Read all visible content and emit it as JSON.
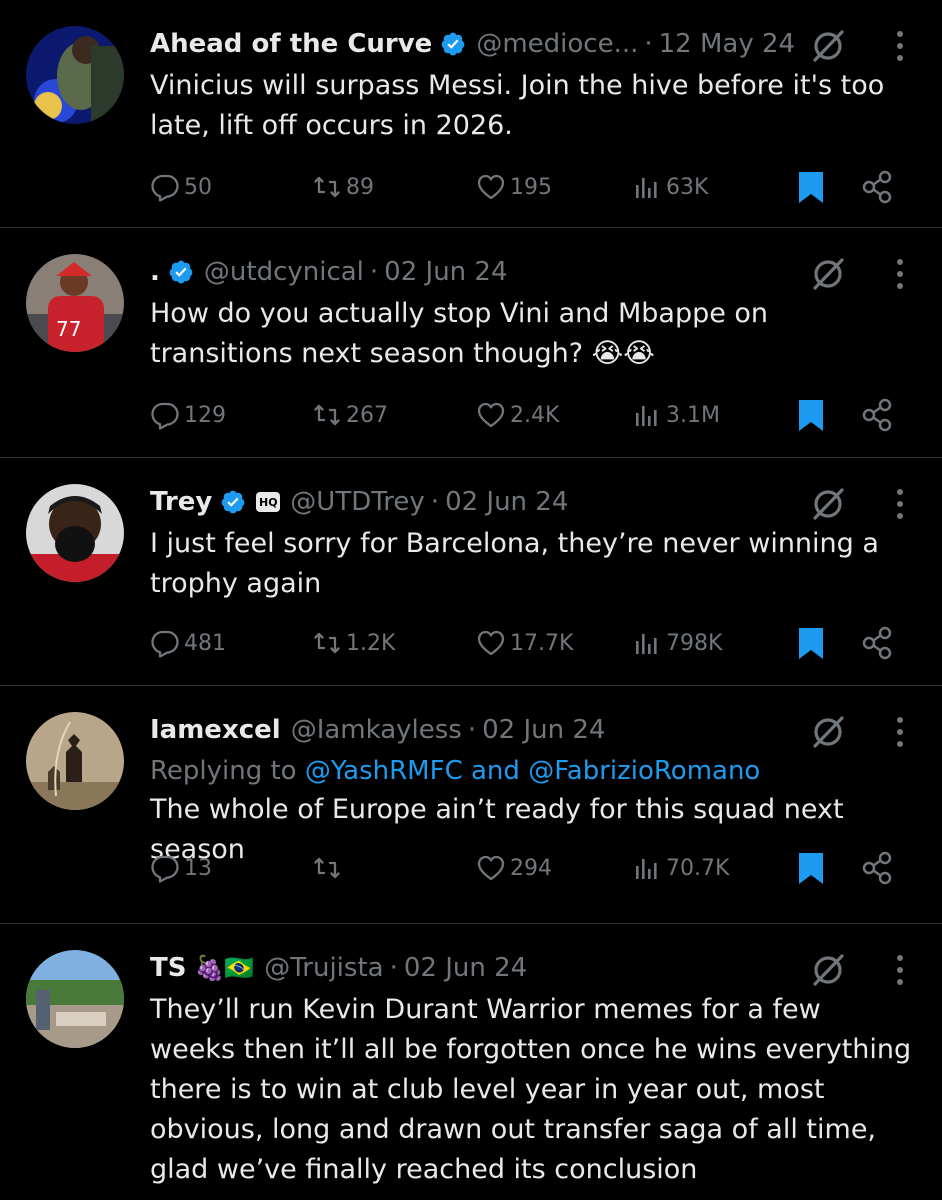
{
  "colors": {
    "background": "#000000",
    "text": "#e7e9ea",
    "muted": "#71767b",
    "accent": "#1d9bf0",
    "divider": "#2f3336"
  },
  "icons": {
    "verified": "verified-badge-icon",
    "grok": "grok-icon",
    "more": "more-vertical-icon",
    "reply": "reply-icon",
    "retweet": "retweet-icon",
    "like": "heart-icon",
    "views": "analytics-icon",
    "bookmark": "bookmark-icon",
    "share": "share-icon"
  },
  "tweets": [
    {
      "name": "Ahead of the Curve",
      "handle": "@medioce...",
      "date": "12 May 24",
      "text": "Vinicius will surpass Messi. Join the hive before it's too late, lift off occurs in 2026.",
      "replies": "50",
      "retweets": "89",
      "likes": "195",
      "views": "63K"
    },
    {
      "name": ".",
      "handle": "@utdcynical",
      "date": "02 Jun 24",
      "text": "How do you actually stop Vini and Mbappe on transitions next season though? 😭😭",
      "replies": "129",
      "retweets": "267",
      "likes": "2.4K",
      "views": "3.1M"
    },
    {
      "name": "Trey",
      "handle": "@UTDTrey",
      "date": "02 Jun 24",
      "text": "I just feel sorry for Barcelona, they’re never winning a trophy again",
      "replies": "481",
      "retweets": "1.2K",
      "likes": "17.7K",
      "views": "798K"
    },
    {
      "name": "Iamexcel",
      "handle": "@Iamkayless",
      "date": "02 Jun 24",
      "reply_prefix": "Replying to ",
      "reply_mention_1": "@YashRMFC",
      "reply_and": " and ",
      "reply_mention_2": "@FabrizioRomano",
      "text": "The whole of Europe ain’t ready for this squad next season",
      "replies": "13",
      "retweets": "",
      "likes": "294",
      "views": "70.7K"
    },
    {
      "name": "TS",
      "name_emoji": "🍇🇧🇷",
      "handle": "@Trujista",
      "date": "02 Jun 24",
      "text": "They’ll run Kevin Durant Warrior memes for a few weeks then it’ll all be forgotten once he wins everything there is to win at club level year in year out, most obvious, long and drawn out transfer saga of all time, glad we’ve finally reached its conclusion"
    }
  ],
  "separator": "·"
}
